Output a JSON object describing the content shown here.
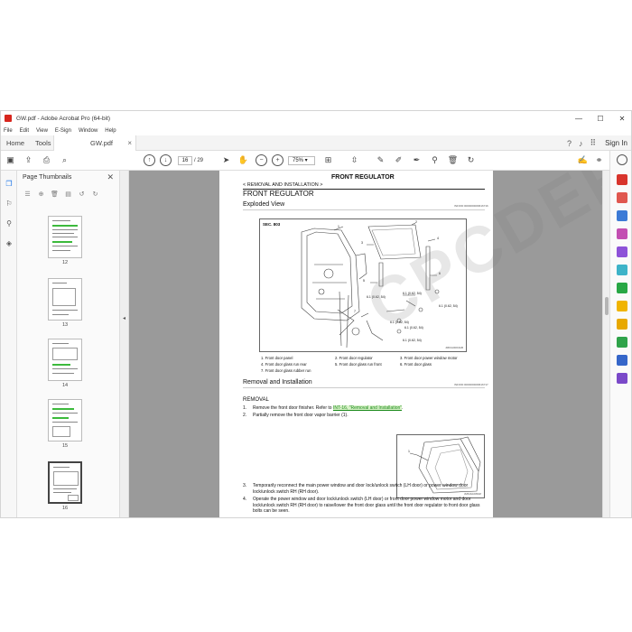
{
  "window": {
    "title": "GW.pdf - Adobe Acrobat Pro (64-bit)",
    "minimize": "—",
    "maximize": "☐",
    "close": "✕"
  },
  "menu": [
    "File",
    "Edit",
    "View",
    "E-Sign",
    "Window",
    "Help"
  ],
  "tabs": {
    "home": "Home",
    "tools": "Tools",
    "doc": "GW.pdf",
    "doc_close": "×",
    "sign_in": "Sign In"
  },
  "toolbar": {
    "page_current": "16",
    "page_total": "/  29",
    "zoom": "75%"
  },
  "thumbnails": {
    "header": "Page Thumbnails",
    "close": "✕",
    "pages": [
      "12",
      "13",
      "14",
      "15",
      "16"
    ],
    "selected": "16"
  },
  "document": {
    "header": "FRONT REGULATOR",
    "breadcrumb": "< REMOVAL AND INSTALLATION >",
    "title": "FRONT REGULATOR",
    "exploded_view": {
      "heading": "Exploded View",
      "code": "INFOID:0000000009616716",
      "sec": "SEC. 803",
      "callouts": [
        "1",
        "2",
        "3",
        "4",
        "5",
        "6",
        "7"
      ],
      "torque": [
        "6.1 (0.62, 54)",
        "6.1 (0.62, 54)",
        "6.1 (0.62, 54)",
        "6.1 (0.62, 54)",
        "6.1 (0.62, 54)",
        "6.1 (0.62, 54)"
      ],
      "figure_code": "JMKIA0004GB",
      "legend": [
        "1.   Front door panel",
        "2.   Front door regulator",
        "3.   Front door power window motor",
        "4.   Front door glass run rear",
        "5.   Front door glass run front",
        "6.   Front door glass",
        "7.   Front door glass rubber run"
      ]
    },
    "removal_installation": {
      "heading": "Removal and Installation",
      "code": "INFOID:0000000009616717",
      "subheading": "REMOVAL",
      "steps": [
        {
          "n": "1.",
          "text": "Remove the front door finisher. Refer to ",
          "link": "INT-16, \"Removal and Installation\"",
          "end": "."
        },
        {
          "n": "2.",
          "text": "Partially remove the front door vapor barrier (1).",
          "link": "",
          "end": ""
        },
        {
          "n": "3.",
          "text": "Temporarily reconnect the main power window and door lock/unlock switch (LH door) or power window door lock/unlock switch RH (RH door).",
          "link": "",
          "end": ""
        },
        {
          "n": "4.",
          "text": "Operate the power window and door lock/unlock switch (LH door) or front door power window motor and door lock/unlock switch RH (RH door) to raise/lower the front door glass until the front door regulator to front door glass bolts can be seen.",
          "link": "",
          "end": ""
        }
      ],
      "figure_code": "JMKIA0205ZZ"
    },
    "watermark": "CPCDEPOT.COM"
  }
}
